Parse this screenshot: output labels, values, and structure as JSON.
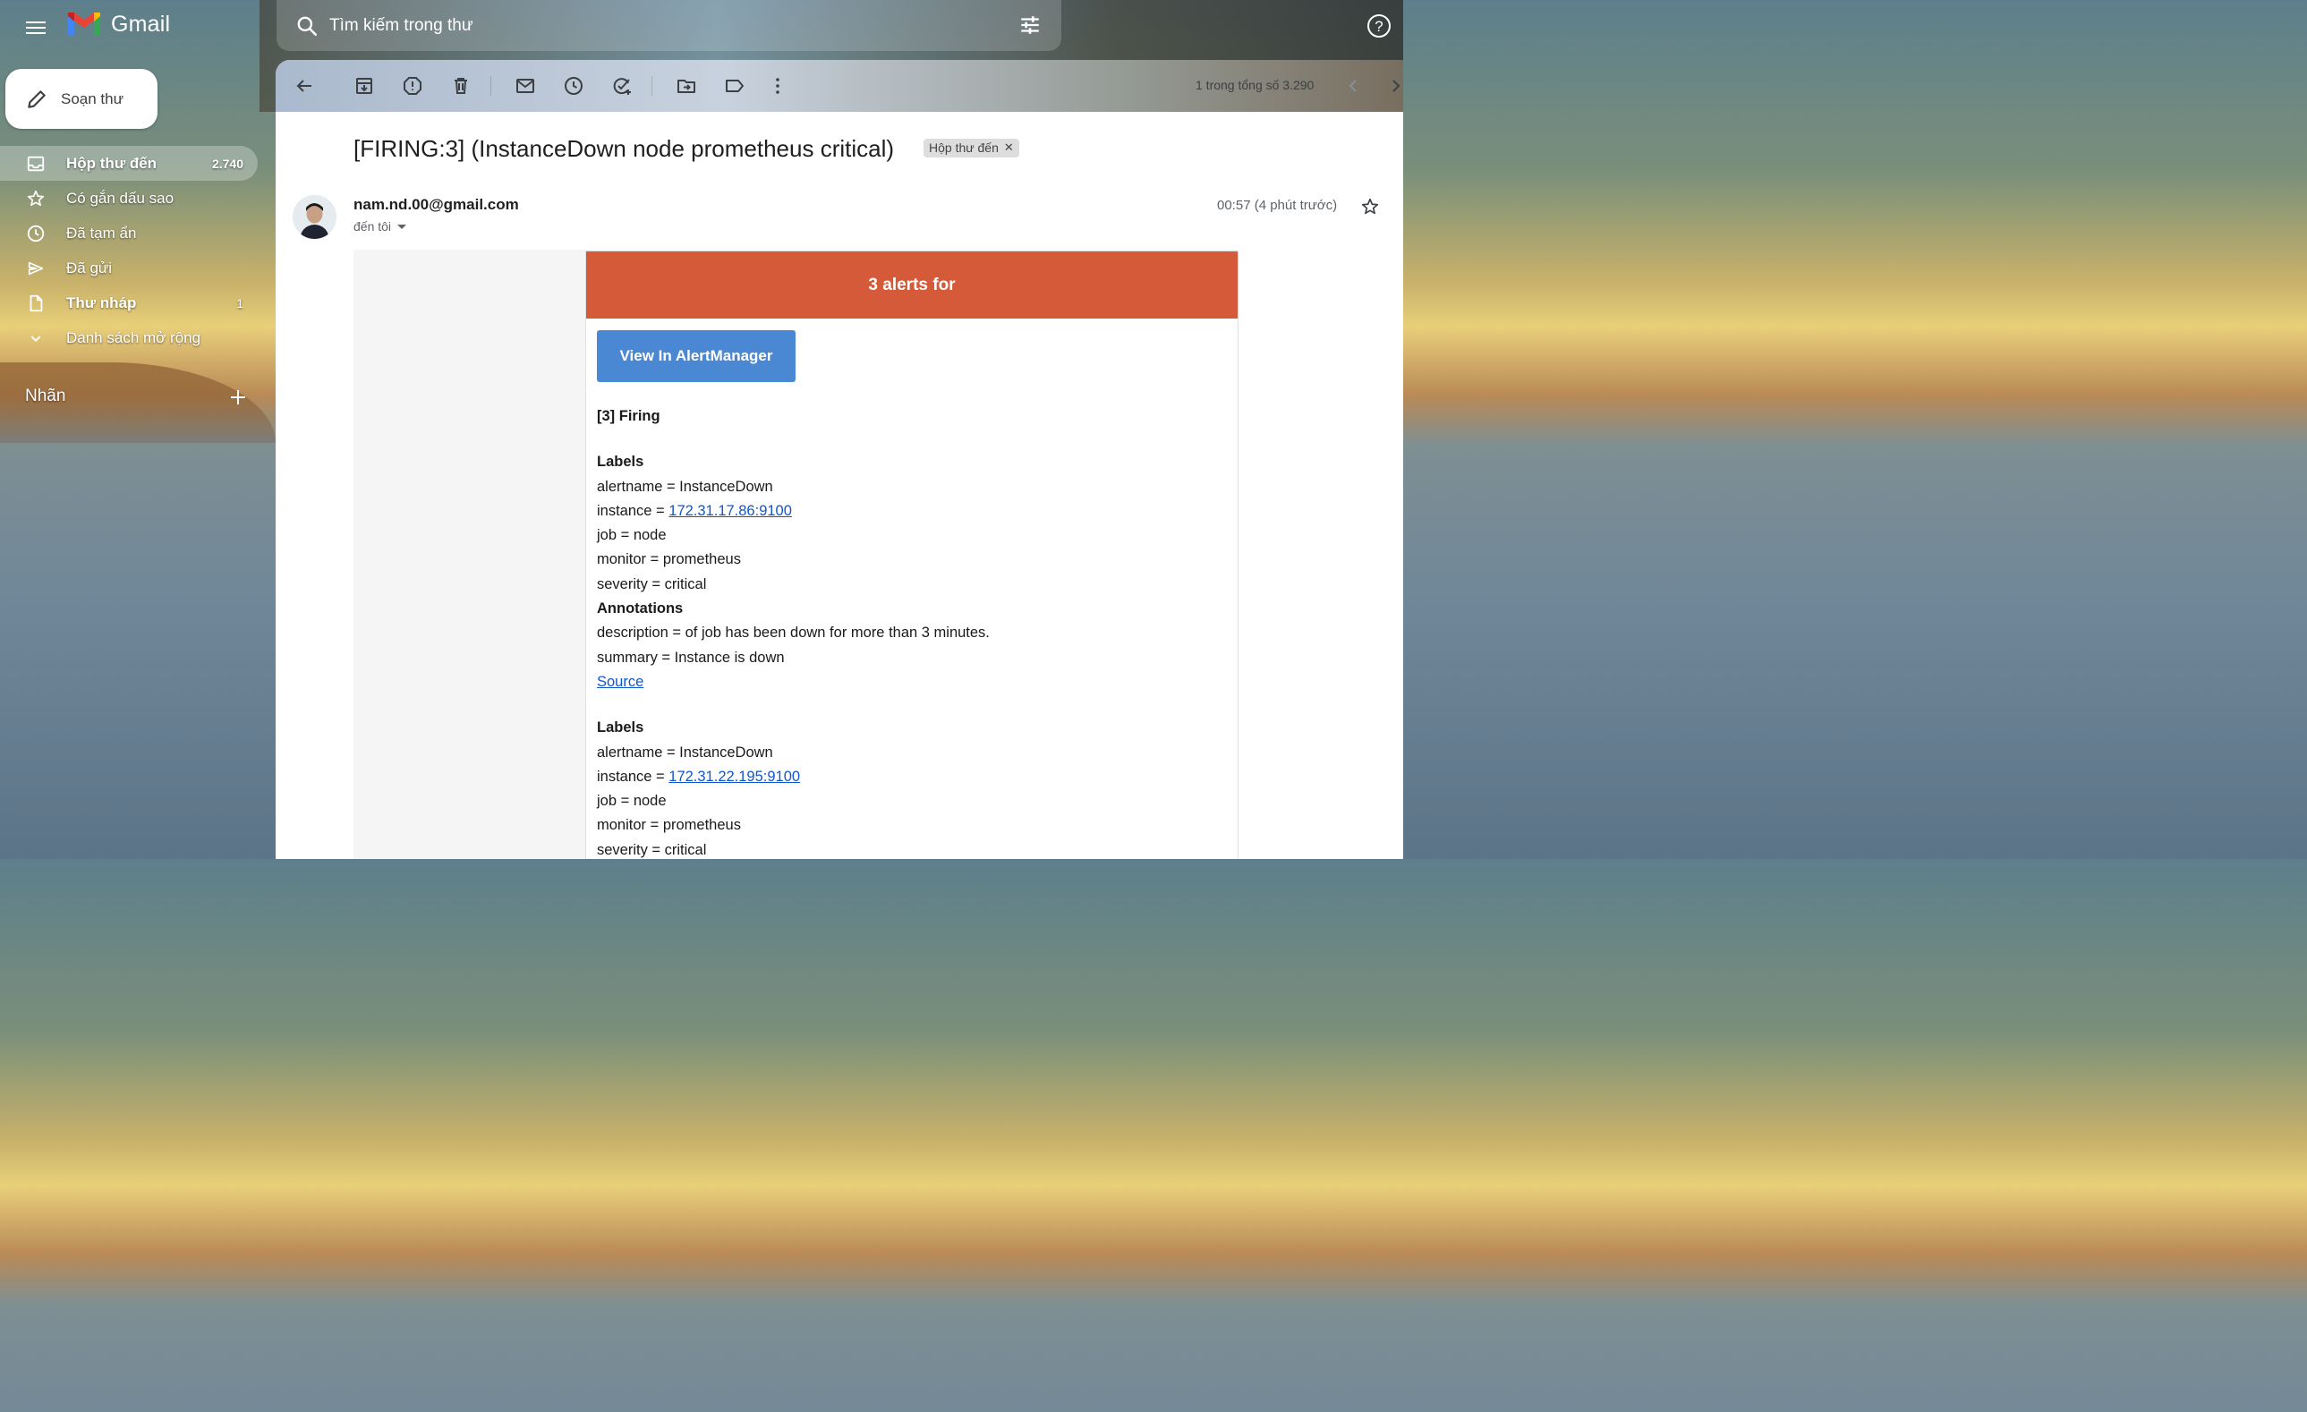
{
  "app": {
    "name": "Gmail"
  },
  "search": {
    "placeholder": "Tìm kiếm trong thư"
  },
  "compose": {
    "label": "Soạn thư"
  },
  "sidebar": {
    "items": [
      {
        "label": "Hộp thư đến",
        "count": "2.740",
        "icon": "inbox-icon"
      },
      {
        "label": "Có gắn dấu sao",
        "count": "",
        "icon": "star-icon"
      },
      {
        "label": "Đã tạm ẩn",
        "count": "",
        "icon": "clock-icon"
      },
      {
        "label": "Đã gửi",
        "count": "",
        "icon": "send-icon"
      },
      {
        "label": "Thư nháp",
        "count": "1",
        "icon": "draft-icon"
      },
      {
        "label": "Danh sách mở rộng",
        "count": "",
        "icon": "chevron-down-icon"
      }
    ],
    "labels_header": "Nhãn"
  },
  "toolbar": {
    "pager": "1 trong tổng số 3.290"
  },
  "email": {
    "subject": "[FIRING:3] (InstanceDown node prometheus critical)",
    "chip": "Hộp thư đến",
    "sender": "nam.nd.00@gmail.com",
    "to": "đến tôi",
    "time": "00:57 (4 phút trước)",
    "body": {
      "header": "3 alerts for",
      "button": "View In AlertManager",
      "firing": "[3] Firing",
      "alerts": [
        {
          "labels_title": "Labels",
          "alertname": "alertname = InstanceDown",
          "instance_prefix": "instance = ",
          "instance": "172.31.17.86:9100",
          "job": "job = node",
          "monitor": "monitor = prometheus",
          "severity": "severity = critical",
          "annotations_title": "Annotations",
          "description": "description = of job has been down for more than 3 minutes.",
          "summary": "summary = Instance is down",
          "source": "Source"
        },
        {
          "labels_title": "Labels",
          "alertname": "alertname = InstanceDown",
          "instance_prefix": "instance = ",
          "instance": "172.31.22.195:9100",
          "job": "job = node",
          "monitor": "monitor = prometheus",
          "severity": "severity = critical"
        }
      ]
    }
  },
  "colors": {
    "alert_header": "#d55a3a",
    "button": "#4a88d4",
    "link": "#1155cc"
  }
}
